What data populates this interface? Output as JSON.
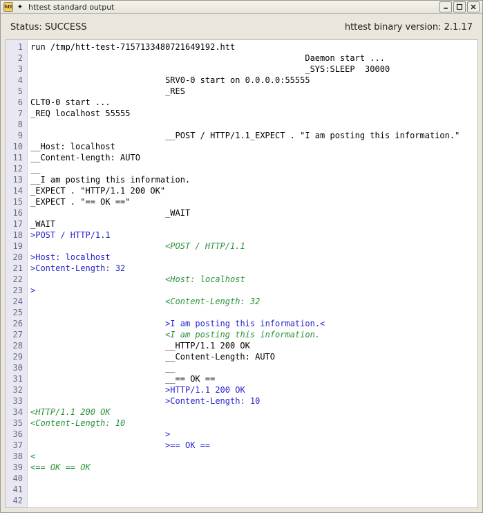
{
  "titlebar": {
    "app_icon_text": "htt",
    "deco_icon": "✦",
    "title": "httest standard output"
  },
  "status": {
    "label": "Status: ",
    "value": "SUCCESS",
    "version_label": "httest binary version: ",
    "version_value": "2.1.17"
  },
  "lines": [
    {
      "n": 1,
      "segs": [
        {
          "t": "run /tmp/htt-test-7157133480721649192.htt",
          "c": "c-black"
        }
      ]
    },
    {
      "n": 2,
      "segs": [
        {
          "t": "                                                       Daemon start ...",
          "c": "c-black"
        }
      ]
    },
    {
      "n": 3,
      "segs": [
        {
          "t": "                                                       _SYS:SLEEP  30000",
          "c": "c-black"
        }
      ]
    },
    {
      "n": 4,
      "segs": [
        {
          "t": "                           SRV0-0 start on 0.0.0.0:55555",
          "c": "c-black"
        }
      ]
    },
    {
      "n": 5,
      "segs": [
        {
          "t": "                           _RES",
          "c": "c-black"
        }
      ]
    },
    {
      "n": 6,
      "segs": [
        {
          "t": "CLT0-0 start ...",
          "c": "c-black"
        }
      ]
    },
    {
      "n": 7,
      "segs": [
        {
          "t": "_REQ localhost 55555",
          "c": "c-black"
        }
      ]
    },
    {
      "n": 8,
      "segs": [
        {
          "t": "",
          "c": "c-black"
        }
      ]
    },
    {
      "n": 9,
      "segs": [
        {
          "t": "                           __POST / HTTP/1.1_EXPECT . \"I am posting this information.\"",
          "c": "c-black"
        }
      ]
    },
    {
      "n": 10,
      "segs": [
        {
          "t": "__Host: localhost",
          "c": "c-black"
        }
      ]
    },
    {
      "n": 11,
      "segs": [
        {
          "t": "__Content-length: AUTO",
          "c": "c-black"
        }
      ]
    },
    {
      "n": 12,
      "segs": [
        {
          "t": "__",
          "c": "c-black"
        }
      ]
    },
    {
      "n": 13,
      "segs": [
        {
          "t": "__I am posting this information.",
          "c": "c-black"
        }
      ]
    },
    {
      "n": 14,
      "segs": [
        {
          "t": "_EXPECT . \"HTTP/1.1 200 OK\"",
          "c": "c-black"
        }
      ]
    },
    {
      "n": 15,
      "segs": [
        {
          "t": "_EXPECT . \"== OK ==\"",
          "c": "c-black"
        }
      ]
    },
    {
      "n": 16,
      "segs": [
        {
          "t": "                           _WAIT",
          "c": "c-black"
        }
      ]
    },
    {
      "n": 17,
      "segs": [
        {
          "t": "_WAIT",
          "c": "c-black"
        }
      ]
    },
    {
      "n": 18,
      "segs": [
        {
          "t": ">POST / HTTP/1.1",
          "c": "c-blue"
        }
      ]
    },
    {
      "n": 19,
      "segs": [
        {
          "t": "                           ",
          "c": "c-black"
        },
        {
          "t": "<POST / HTTP/1.1",
          "c": "c-green"
        }
      ]
    },
    {
      "n": 20,
      "segs": [
        {
          "t": ">Host: localhost",
          "c": "c-blue"
        }
      ]
    },
    {
      "n": 21,
      "segs": [
        {
          "t": ">Content-Length: 32",
          "c": "c-blue"
        }
      ]
    },
    {
      "n": 22,
      "segs": [
        {
          "t": "                           ",
          "c": "c-black"
        },
        {
          "t": "<Host: localhost",
          "c": "c-green"
        }
      ]
    },
    {
      "n": 23,
      "segs": [
        {
          "t": ">",
          "c": "c-blue"
        }
      ]
    },
    {
      "n": 24,
      "segs": [
        {
          "t": "                           ",
          "c": "c-black"
        },
        {
          "t": "<Content-Length: 32",
          "c": "c-green"
        }
      ]
    },
    {
      "n": 25,
      "segs": [
        {
          "t": "",
          "c": "c-black"
        }
      ]
    },
    {
      "n": 26,
      "segs": [
        {
          "t": "                           ",
          "c": "c-black"
        },
        {
          "t": ">I am posting this information.<",
          "c": "c-blue"
        }
      ]
    },
    {
      "n": 27,
      "segs": [
        {
          "t": "                           ",
          "c": "c-black"
        },
        {
          "t": "<I am posting this information.",
          "c": "c-green"
        }
      ]
    },
    {
      "n": 28,
      "segs": [
        {
          "t": "                           __HTTP/1.1 200 OK",
          "c": "c-black"
        }
      ]
    },
    {
      "n": 29,
      "segs": [
        {
          "t": "                           __Content-Length: AUTO",
          "c": "c-black"
        }
      ]
    },
    {
      "n": 30,
      "segs": [
        {
          "t": "                           __",
          "c": "c-black"
        }
      ]
    },
    {
      "n": 31,
      "segs": [
        {
          "t": "                           __== OK ==",
          "c": "c-black"
        }
      ]
    },
    {
      "n": 32,
      "segs": [
        {
          "t": "                           ",
          "c": "c-black"
        },
        {
          "t": ">HTTP/1.1 200 OK",
          "c": "c-blue"
        }
      ]
    },
    {
      "n": 33,
      "segs": [
        {
          "t": "                           ",
          "c": "c-black"
        },
        {
          "t": ">Content-Length: 10",
          "c": "c-blue"
        }
      ]
    },
    {
      "n": 34,
      "segs": [
        {
          "t": "<HTTP/1.1 200 OK",
          "c": "c-green"
        }
      ]
    },
    {
      "n": 35,
      "segs": [
        {
          "t": "<Content-Length: 10",
          "c": "c-green"
        }
      ]
    },
    {
      "n": 36,
      "segs": [
        {
          "t": "                           ",
          "c": "c-black"
        },
        {
          "t": ">",
          "c": "c-blue"
        }
      ]
    },
    {
      "n": 37,
      "segs": [
        {
          "t": "                           ",
          "c": "c-black"
        },
        {
          "t": ">== OK ==",
          "c": "c-blue"
        }
      ]
    },
    {
      "n": 38,
      "segs": [
        {
          "t": "<",
          "c": "c-green"
        }
      ]
    },
    {
      "n": 39,
      "segs": [
        {
          "t": "<== OK == OK",
          "c": "c-green"
        }
      ]
    },
    {
      "n": 40,
      "segs": [
        {
          "t": "",
          "c": "c-black"
        }
      ]
    },
    {
      "n": 41,
      "segs": [
        {
          "t": "",
          "c": "c-black"
        }
      ]
    },
    {
      "n": 42,
      "segs": [
        {
          "t": "",
          "c": "c-black"
        }
      ]
    }
  ]
}
